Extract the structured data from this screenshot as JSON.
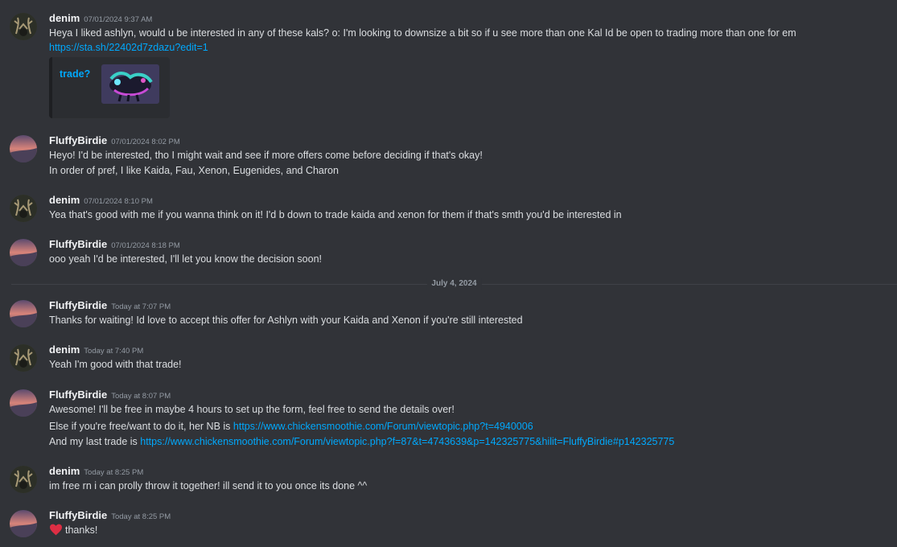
{
  "date_divider": "July 4, 2024",
  "messages": [
    {
      "author": "denim",
      "time": "07/01/2024 9:37 AM",
      "lines": [
        "Heya I liked ashlyn, would u be interested in any of these kals? o: I'm looking to downsize a bit so if u see more than one Kal Id be open to trading more than one for em"
      ],
      "link": "https://sta.sh/22402d7zdazu?edit=1",
      "embed_title": "trade?"
    },
    {
      "author": "FluffyBirdie",
      "time": "07/01/2024 8:02 PM",
      "lines": [
        "Heyo! I'd be interested, tho I might wait and see if more offers come before deciding if that's okay!",
        "In order of pref, I like Kaida, Fau, Xenon, Eugenides, and Charon"
      ]
    },
    {
      "author": "denim",
      "time": "07/01/2024 8:10 PM",
      "lines": [
        "Yea that's good with me if you wanna think on it! I'd b down to trade kaida and xenon for them if that's smth you'd be interested in"
      ]
    },
    {
      "author": "FluffyBirdie",
      "time": "07/01/2024 8:18 PM",
      "lines": [
        "ooo yeah I'd be interested, I'll let you know the decision soon!"
      ]
    },
    {
      "author": "FluffyBirdie",
      "time": "Today at 7:07 PM",
      "lines": [
        "Thanks for waiting! Id love to accept this offer for Ashlyn with your Kaida and Xenon if you're still interested"
      ]
    },
    {
      "author": "denim",
      "time": "Today at 7:40 PM",
      "lines": [
        "Yeah I'm good with that trade!"
      ]
    },
    {
      "author": "FluffyBirdie",
      "time": "Today at 8:07 PM",
      "line1": "Awesome! I'll be free in maybe 4 hours to set up the form, feel free to send the details over!",
      "line2_text": "Else if you're free/want to do it, her NB is ",
      "line2_link": "https://www.chickensmoothie.com/Forum/viewtopic.php?t=4940006",
      "line3_text": "And my last trade is ",
      "line3_link": "https://www.chickensmoothie.com/Forum/viewtopic.php?f=87&t=4743639&p=142325775&hilit=FluffyBirdie#p142325775"
    },
    {
      "author": "denim",
      "time": "Today at 8:25 PM",
      "lines": [
        "im free rn i can prolly throw it together! ill send it to you once its done ^^"
      ]
    },
    {
      "author": "FluffyBirdie",
      "time": "Today at 8:25 PM",
      "lines": [
        "thanks!"
      ],
      "emoji": "heart-icon"
    }
  ],
  "colors": {
    "background": "#313338",
    "username": "#f2f3f5",
    "text": "#dbdee1",
    "timestamp": "#949ba4",
    "link": "#00a8fc"
  }
}
